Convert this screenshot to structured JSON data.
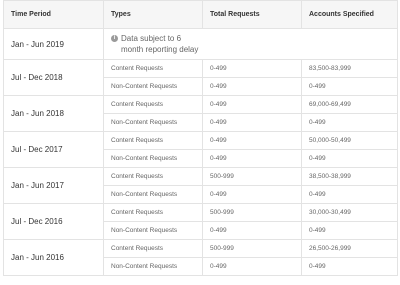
{
  "table": {
    "headers": [
      "Time Period",
      "Types",
      "Total Requests",
      "Accounts Specified"
    ],
    "note_icon": "info-icon",
    "groups": [
      {
        "period": "Jan - Jun 2019",
        "note": "Data subject to 6 month reporting delay"
      },
      {
        "period": "Jul - Dec 2018",
        "rows": [
          {
            "type": "Content Requests",
            "requests": "0-499",
            "accounts": "83,500-83,999"
          },
          {
            "type": "Non-Content Requests",
            "requests": "0-499",
            "accounts": "0-499"
          }
        ]
      },
      {
        "period": "Jan - Jun 2018",
        "rows": [
          {
            "type": "Content Requests",
            "requests": "0-499",
            "accounts": "69,000-69,499"
          },
          {
            "type": "Non-Content Requests",
            "requests": "0-499",
            "accounts": "0-499"
          }
        ]
      },
      {
        "period": "Jul - Dec 2017",
        "rows": [
          {
            "type": "Content Requests",
            "requests": "0-499",
            "accounts": "50,000-50,499"
          },
          {
            "type": "Non-Content Requests",
            "requests": "0-499",
            "accounts": "0-499"
          }
        ]
      },
      {
        "period": "Jan - Jun 2017",
        "rows": [
          {
            "type": "Content Requests",
            "requests": "500-999",
            "accounts": "38,500-38,999"
          },
          {
            "type": "Non-Content Requests",
            "requests": "0-499",
            "accounts": "0-499"
          }
        ]
      },
      {
        "period": "Jul - Dec 2016",
        "rows": [
          {
            "type": "Content Requests",
            "requests": "500-999",
            "accounts": "30,000-30,499"
          },
          {
            "type": "Non-Content Requests",
            "requests": "0-499",
            "accounts": "0-499"
          }
        ]
      },
      {
        "period": "Jan - Jun 2016",
        "rows": [
          {
            "type": "Content Requests",
            "requests": "500-999",
            "accounts": "26,500-26,999"
          },
          {
            "type": "Non-Content Requests",
            "requests": "0-499",
            "accounts": "0-499"
          }
        ]
      }
    ]
  }
}
